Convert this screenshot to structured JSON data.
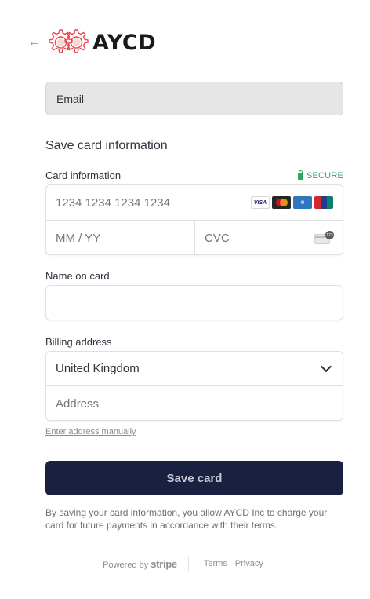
{
  "header": {
    "brand_name": "AYCD"
  },
  "email": {
    "placeholder": "Email"
  },
  "card_section": {
    "title": "Save card information",
    "label": "Card information",
    "secure_label": "SECURE",
    "number_placeholder": "1234 1234 1234 1234",
    "expiry_placeholder": "MM / YY",
    "cvc_placeholder": "CVC",
    "brands": [
      {
        "name": "visa-icon",
        "text": "VISA"
      },
      {
        "name": "mastercard-icon",
        "text": ""
      },
      {
        "name": "amex-icon",
        "text": ""
      },
      {
        "name": "unionpay-icon",
        "text": ""
      }
    ]
  },
  "name_field": {
    "label": "Name on card",
    "value": ""
  },
  "billing": {
    "label": "Billing address",
    "country": "United Kingdom",
    "address_placeholder": "Address",
    "manual_link": "Enter address manually"
  },
  "save_button": {
    "label": "Save card"
  },
  "terms_text": "By saving your card information, you allow AYCD Inc to charge your card for future payments in accordance with their terms.",
  "footer": {
    "powered_by": "Powered by",
    "stripe": "stripe",
    "terms": "Terms",
    "privacy": "Privacy"
  },
  "colors": {
    "button_bg": "#1a2040",
    "secure_green": "#2fa463",
    "logo_red": "#e8474c"
  }
}
